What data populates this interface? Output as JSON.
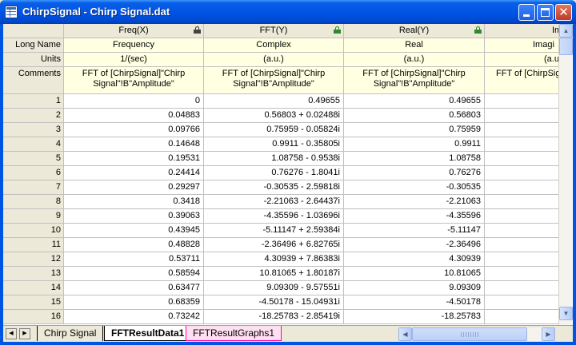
{
  "window": {
    "title": "ChirpSignal - Chirp Signal.dat",
    "minimize_glyph": "minimize-icon",
    "maximize_glyph": "maximize-icon",
    "close_glyph": "✕"
  },
  "columns": [
    {
      "header": "Freq(X)",
      "long_name": "Frequency",
      "units": "1/(sec)",
      "comments": "FFT of [ChirpSignal]\"Chirp Signal\"!B\"Amplitude\"",
      "lock": "lock-dark-icon"
    },
    {
      "header": "FFT(Y)",
      "long_name": "Complex",
      "units": "(a.u.)",
      "comments": "FFT of [ChirpSignal]\"Chirp Signal\"!B\"Amplitude\"",
      "lock": "lock-icon"
    },
    {
      "header": "Real(Y)",
      "long_name": "Real",
      "units": "(a.u.)",
      "comments": "FFT of [ChirpSignal]\"Chirp Signal\"!B\"Amplitude\"",
      "lock": "lock-icon"
    },
    {
      "header": "Imag",
      "long_name": "Imagi",
      "units": "(a.u.",
      "comments": "FFT of [ChirpSig Signal\"!B\"A",
      "lock": ""
    }
  ],
  "row_labels": {
    "long_name": "Long Name",
    "units": "Units",
    "comments": "Comments"
  },
  "rows": [
    {
      "n": "1",
      "freq": "0",
      "fft": "0.49655",
      "real": "0.49655"
    },
    {
      "n": "2",
      "freq": "0.04883",
      "fft": "0.56803 + 0.02488i",
      "real": "0.56803"
    },
    {
      "n": "3",
      "freq": "0.09766",
      "fft": "0.75959 - 0.05824i",
      "real": "0.75959"
    },
    {
      "n": "4",
      "freq": "0.14648",
      "fft": "0.9911 - 0.35805i",
      "real": "0.9911"
    },
    {
      "n": "5",
      "freq": "0.19531",
      "fft": "1.08758 - 0.9538i",
      "real": "1.08758"
    },
    {
      "n": "6",
      "freq": "0.24414",
      "fft": "0.76276 - 1.8041i",
      "real": "0.76276"
    },
    {
      "n": "7",
      "freq": "0.29297",
      "fft": "-0.30535 - 2.59818i",
      "real": "-0.30535"
    },
    {
      "n": "8",
      "freq": "0.3418",
      "fft": "-2.21063 - 2.64437i",
      "real": "-2.21063"
    },
    {
      "n": "9",
      "freq": "0.39063",
      "fft": "-4.35596 - 1.03696i",
      "real": "-4.35596"
    },
    {
      "n": "10",
      "freq": "0.43945",
      "fft": "-5.11147 + 2.59384i",
      "real": "-5.11147"
    },
    {
      "n": "11",
      "freq": "0.48828",
      "fft": "-2.36496 + 6.82765i",
      "real": "-2.36496"
    },
    {
      "n": "12",
      "freq": "0.53711",
      "fft": "4.30939 + 7.86383i",
      "real": "4.30939"
    },
    {
      "n": "13",
      "freq": "0.58594",
      "fft": "10.81065 + 1.80187i",
      "real": "10.81065"
    },
    {
      "n": "14",
      "freq": "0.63477",
      "fft": "9.09309 - 9.57551i",
      "real": "9.09309"
    },
    {
      "n": "15",
      "freq": "0.68359",
      "fft": "-4.50178 - 15.04931i",
      "real": "-4.50178"
    },
    {
      "n": "16",
      "freq": "0.73242",
      "fft": "-18.25783 - 2.85419i",
      "real": "-18.25783"
    }
  ],
  "sheet_tabs": [
    {
      "label": "Chirp Signal",
      "active": false
    },
    {
      "label": "FFTResultData1",
      "active": true
    },
    {
      "label": "FFTResultGraphs1",
      "active": false,
      "color": "#ff00aa"
    }
  ],
  "nav": {
    "prev": "◀",
    "next": "▶",
    "up": "▲",
    "down": "▼",
    "left": "◀",
    "right": "▶"
  }
}
